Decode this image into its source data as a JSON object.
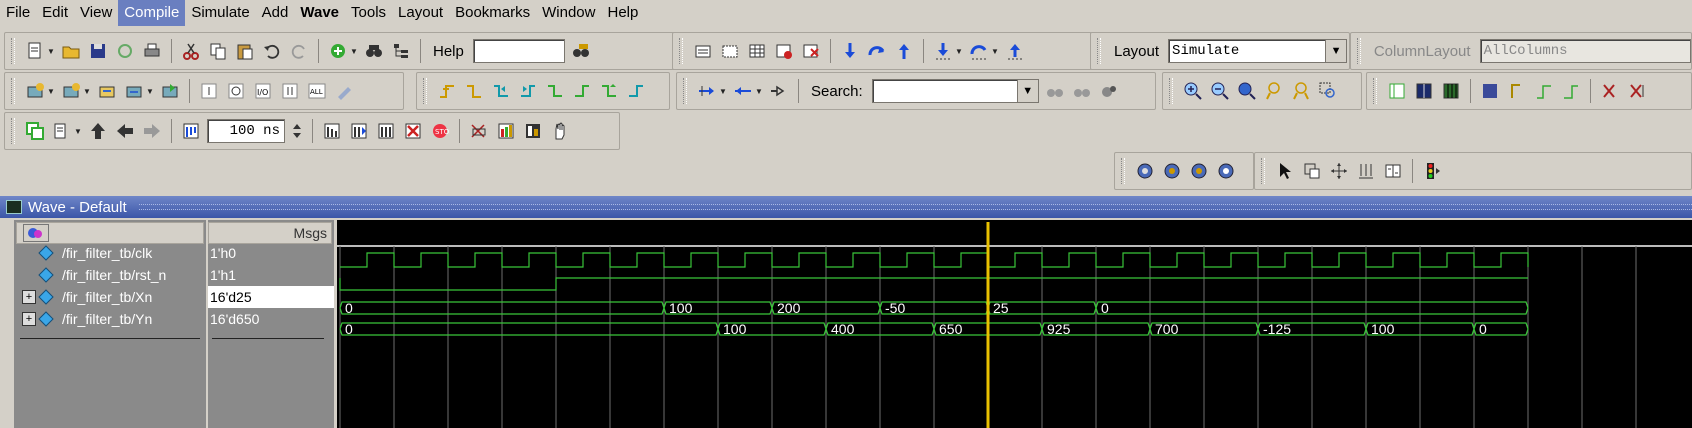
{
  "menu": [
    "File",
    "Edit",
    "View",
    "Compile",
    "Simulate",
    "Add",
    "Wave",
    "Tools",
    "Layout",
    "Bookmarks",
    "Window",
    "Help"
  ],
  "menu_active": "Compile",
  "menu_bold": "Wave",
  "toolbar": {
    "help_label": "Help",
    "help_value": "",
    "layout_label": "Layout",
    "layout_value": "Simulate",
    "column_layout_label": "ColumnLayout",
    "column_layout_value": "AllColumns",
    "search_label": "Search:",
    "search_value": "",
    "runtime_value": "100 ns"
  },
  "wave": {
    "title": "Wave - Default",
    "msgs_header": "Msgs",
    "signals": [
      {
        "name": "/fir_filter_tb/clk",
        "value": "1'h0",
        "expandable": false
      },
      {
        "name": "/fir_filter_tb/rst_n",
        "value": "1'h1",
        "expandable": false
      },
      {
        "name": "/fir_filter_tb/Xn",
        "value": "16'd25",
        "expandable": true
      },
      {
        "name": "/fir_filter_tb/Yn",
        "value": "16'd650",
        "expandable": true
      }
    ],
    "bus_labels": {
      "xn": [
        "0",
        "100",
        "200",
        "-50",
        "25",
        "0"
      ],
      "yn": [
        "0",
        "100",
        "400",
        "650",
        "925",
        "700",
        "-125",
        "100",
        "0"
      ]
    },
    "colors": {
      "wave": "#39c539",
      "cursor": "#e8c000",
      "grid": "#6e6e6e",
      "title_bar": "#4a62b4"
    }
  }
}
